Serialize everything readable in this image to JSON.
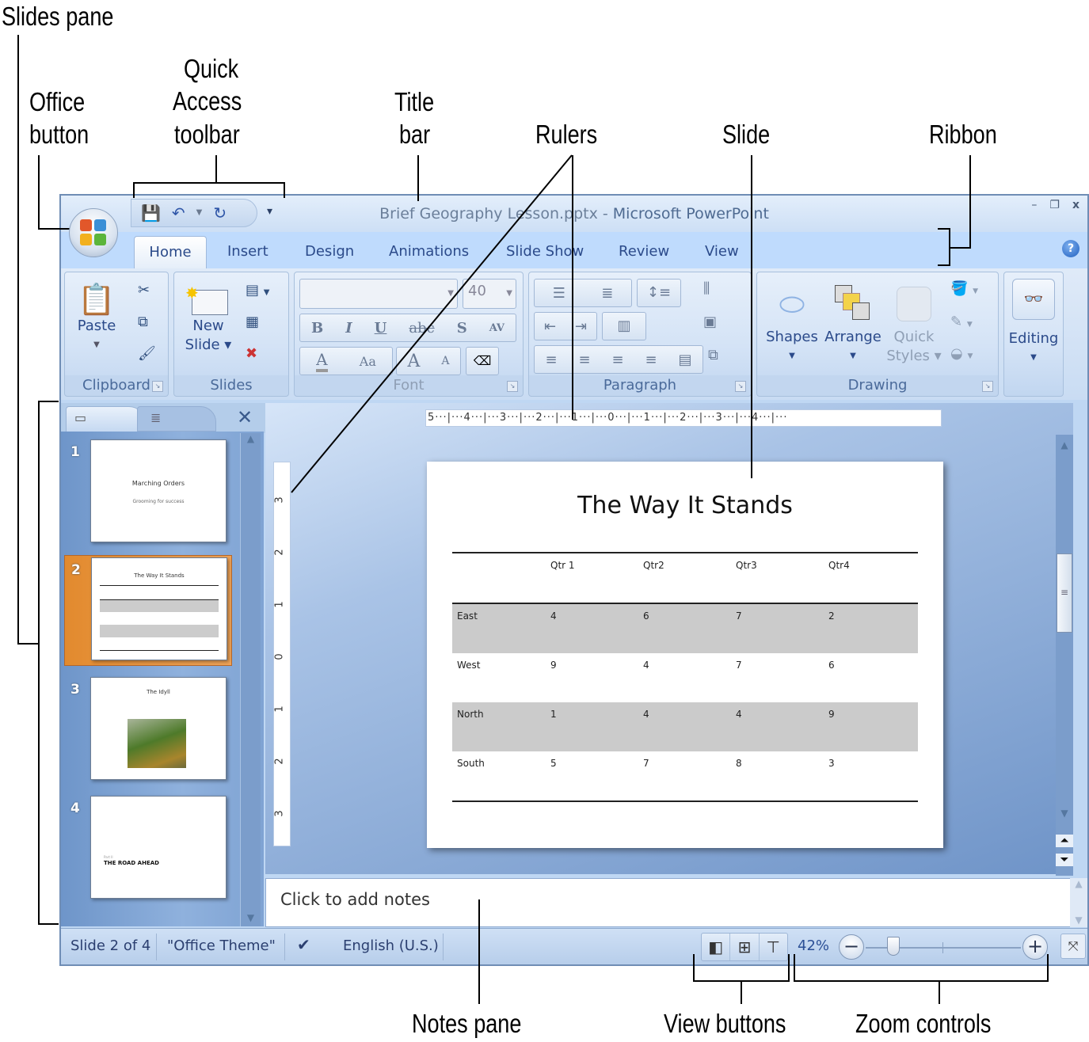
{
  "callouts": {
    "slides_pane": "Slides pane",
    "office_button": [
      "Office",
      "button"
    ],
    "quick_access": [
      "Quick",
      "Access",
      "toolbar"
    ],
    "title_bar": [
      "Title",
      "bar"
    ],
    "rulers": "Rulers",
    "slide": "Slide",
    "ribbon": "Ribbon",
    "notes_pane": "Notes pane",
    "view_buttons": "View buttons",
    "zoom_controls": "Zoom controls"
  },
  "window": {
    "document_name": "Brief Geography Lesson.pptx",
    "separator": " - ",
    "app_name": "Microsoft PowerPoint",
    "controls": [
      "–",
      "❐",
      "x"
    ]
  },
  "qat": {
    "save": "save-icon",
    "undo": "undo-icon",
    "redo": "redo-icon",
    "customize": "▾"
  },
  "tabs": [
    "Home",
    "Insert",
    "Design",
    "Animations",
    "Slide Show",
    "Review",
    "View"
  ],
  "active_tab": "Home",
  "ribbon": {
    "clipboard": {
      "label": "Clipboard",
      "paste": "Paste"
    },
    "slides": {
      "label": "Slides",
      "new_slide": [
        "New",
        "Slide ▾"
      ]
    },
    "font": {
      "label": "Font",
      "font_name": "",
      "font_size": "40",
      "buttons": [
        "B",
        "I",
        "U",
        "abc",
        "S",
        "AV"
      ],
      "row3": [
        "A",
        "Aa",
        "A",
        "A"
      ]
    },
    "paragraph": {
      "label": "Paragraph"
    },
    "drawing": {
      "label": "Drawing",
      "shapes": "Shapes",
      "arrange": "Arrange",
      "quick_styles": [
        "Quick",
        "Styles ▾"
      ]
    },
    "editing": {
      "label": "Editing"
    }
  },
  "slides_pane": {
    "thumbnails": [
      {
        "number": "1",
        "title": "Marching Orders",
        "subtitle": "Grooming for success"
      },
      {
        "number": "2",
        "title": "The Way It Stands",
        "subtitle": ""
      },
      {
        "number": "3",
        "title": "The Idyll",
        "subtitle": ""
      },
      {
        "number": "4",
        "title": "THE ROAD AHEAD",
        "subtitle": "Part II"
      }
    ],
    "selected": 2
  },
  "rulers": {
    "horizontal": "5···|···4···|···3···|···2···|···1···|···0···|···1···|···2···|···3···|···4···|···",
    "vertical_labels": [
      "3",
      "2",
      "1",
      "0",
      "1",
      "2",
      "3"
    ]
  },
  "slide": {
    "title": "The Way It Stands",
    "table": {
      "headers": [
        "",
        "Qtr 1",
        "Qtr2",
        "Qtr3",
        "Qtr4"
      ],
      "rows": [
        {
          "label": "East",
          "values": [
            "4",
            "6",
            "7",
            "2"
          ]
        },
        {
          "label": "West",
          "values": [
            "9",
            "4",
            "7",
            "6"
          ]
        },
        {
          "label": "North",
          "values": [
            "1",
            "4",
            "4",
            "9"
          ]
        },
        {
          "label": "South",
          "values": [
            "5",
            "7",
            "8",
            "3"
          ]
        }
      ]
    }
  },
  "notes": {
    "placeholder": "Click to add notes"
  },
  "status": {
    "slide_info": "Slide 2 of 4",
    "theme": "\"Office Theme\"",
    "language": "English (U.S.)",
    "zoom": "42%",
    "zoom_fraction": 0.42
  }
}
